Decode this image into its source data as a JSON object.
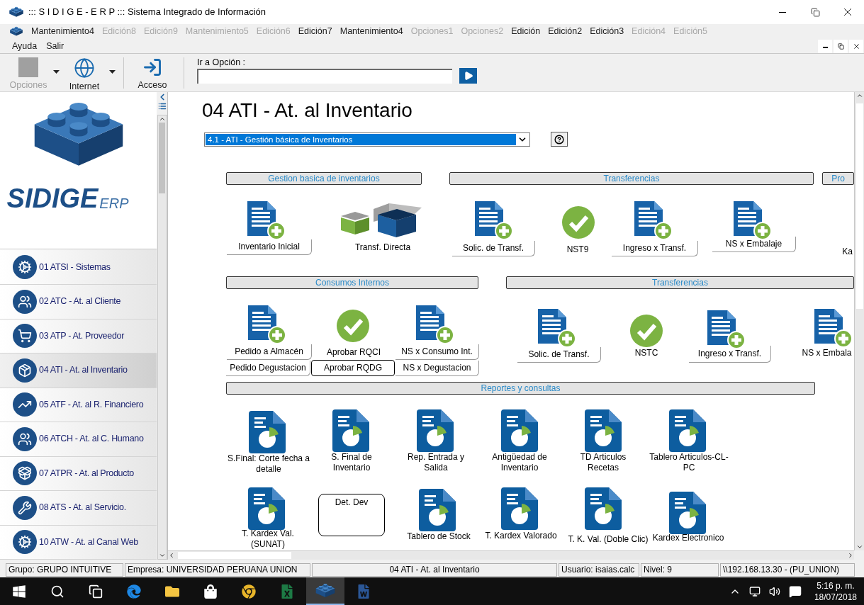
{
  "window": {
    "title": "::: S I D I G E - E R P ::: Sistema Integrado de Información"
  },
  "menu": [
    {
      "label": "Mantenimiento4",
      "disabled": false
    },
    {
      "label": "Edición8",
      "disabled": true
    },
    {
      "label": "Edición9",
      "disabled": true
    },
    {
      "label": "Mantenimiento5",
      "disabled": true
    },
    {
      "label": "Edición6",
      "disabled": true
    },
    {
      "label": "Edición7",
      "disabled": false
    },
    {
      "label": "Mantenimiento4",
      "disabled": false
    },
    {
      "label": "Opciones1",
      "disabled": true
    },
    {
      "label": "Opciones2",
      "disabled": true
    },
    {
      "label": "Edición",
      "disabled": false
    },
    {
      "label": "Edición2",
      "disabled": false
    },
    {
      "label": "Edición3",
      "disabled": false
    },
    {
      "label": "Edición4",
      "disabled": true
    },
    {
      "label": "Edición5",
      "disabled": true
    }
  ],
  "menu_row2": [
    {
      "label": "Ayuda",
      "disabled": false
    },
    {
      "label": "Salir",
      "disabled": false
    }
  ],
  "toolbar": {
    "buttons": [
      {
        "label": "Opciones",
        "kind": "blank",
        "disabled": true,
        "dropdown": true
      },
      {
        "label": "Internet",
        "kind": "globe",
        "disabled": false,
        "dropdown": true
      },
      {
        "label": "Acceso",
        "kind": "door",
        "disabled": false,
        "dropdown": false
      }
    ],
    "goto_label": "Ir a Opción :"
  },
  "sidebar": {
    "logo": {
      "name": "SIDIGE",
      "suffix": "ERP"
    },
    "items": [
      {
        "label": "01 ATSI - Sistemas",
        "kind": "gears",
        "selected": false
      },
      {
        "label": "02 ATC - At. al Cliente",
        "kind": "people",
        "selected": false
      },
      {
        "label": "03  ATP - At. Proveedor",
        "kind": "cart",
        "selected": false
      },
      {
        "label": "04 ATI - At. al Inventario",
        "kind": "box",
        "selected": true
      },
      {
        "label": "05 ATF - At. al R. Financiero",
        "kind": "chart",
        "selected": false
      },
      {
        "label": "06 ATCH - At. al C. Humano",
        "kind": "group",
        "selected": false
      },
      {
        "label": "07 ATPR - At. al Producto",
        "kind": "package",
        "selected": false
      },
      {
        "label": "08 ATS - At. al Servicio.",
        "kind": "tools",
        "selected": false
      },
      {
        "label": "10 ATW - At. al Canal Web",
        "kind": "gears",
        "selected": false
      }
    ]
  },
  "page": {
    "title": "04 ATI - At. al Inventario",
    "dropdown": {
      "value": "4.1 - ATI - Gestión básica de Inventarios"
    }
  },
  "sections": [
    {
      "title": "Gestion basica de inventarios"
    },
    {
      "title": "Transferencias"
    },
    {
      "title": "Pro"
    },
    {
      "title": "Consumos Internos"
    },
    {
      "title": "Transferencias"
    },
    {
      "title": "Reportes y consultas"
    }
  ],
  "tiles": [
    {
      "kind": "doc-add",
      "label": "Inventario Inicial"
    },
    {
      "kind": "boxes",
      "label": "Transf. Directa"
    },
    {
      "kind": "doc-add",
      "label": "Solic. de Transf."
    },
    {
      "kind": "check",
      "label": "NST9"
    },
    {
      "kind": "doc-add",
      "label": "Ingreso x Transf."
    },
    {
      "kind": "doc-add",
      "label": "NS x Embalaje"
    },
    {
      "kind": "text",
      "label": "Ka"
    },
    {
      "kind": "doc-add",
      "label": "Pedido a Almacén"
    },
    {
      "kind": "check",
      "label": "Aprobar RQCI"
    },
    {
      "kind": "doc-add",
      "label": "NS x Consumo Int."
    },
    {
      "kind": "text",
      "label": "Pedido Degustacion"
    },
    {
      "kind": "text",
      "label": "Aprobar RQDG"
    },
    {
      "kind": "text",
      "label": "NS x Degustacion"
    },
    {
      "kind": "doc-add",
      "label": "Solic. de Transf."
    },
    {
      "kind": "check",
      "label": "NSTC"
    },
    {
      "kind": "doc-add",
      "label": "Ingreso x Transf."
    },
    {
      "kind": "doc-add",
      "label": "NS x Embala"
    },
    {
      "kind": "report",
      "label": "S.Final: Corte fecha a detalle"
    },
    {
      "kind": "report",
      "label": "S. Final de Inventario"
    },
    {
      "kind": "report",
      "label": "Rep. Entrada y Salida"
    },
    {
      "kind": "report",
      "label": "Antigüedad de Inventario"
    },
    {
      "kind": "report",
      "label": "TD Articulos Recetas"
    },
    {
      "kind": "report",
      "label": "Tablero Articulos-CL-PC"
    },
    {
      "kind": "report",
      "label": "T. Kardex Val. (SUNAT)"
    },
    {
      "kind": "text",
      "label": "Det. Dev"
    },
    {
      "kind": "report",
      "label": "Tablero de Stock"
    },
    {
      "kind": "report",
      "label": "T. Kardex Valorado"
    },
    {
      "kind": "report",
      "label": "T. K. Val. (Doble Clic)"
    },
    {
      "kind": "report",
      "label": "Kardex Electronico"
    }
  ],
  "status_bar": [
    "Grupo: GRUPO INTUITIVE",
    "Empresa: UNIVERSIDAD PERUANA UNION",
    "04 ATI - At. al Inventario",
    "Usuario: isaias.calc",
    "Nivel: 9",
    "\\\\192.168.13.30 - (PU_UNION)"
  ],
  "taskbar": {
    "apps": [
      {
        "kind": "start",
        "selected": false
      },
      {
        "kind": "search",
        "selected": false
      },
      {
        "kind": "task-view",
        "selected": false
      },
      {
        "kind": "edge",
        "selected": false
      },
      {
        "kind": "explorer",
        "selected": false
      },
      {
        "kind": "store",
        "selected": false
      },
      {
        "kind": "chrome",
        "selected": false
      },
      {
        "kind": "excel",
        "selected": false
      },
      {
        "kind": "sidige",
        "selected": true
      },
      {
        "kind": "word",
        "selected": false
      }
    ],
    "time": "5:16 p. m.",
    "date": "18/07/2018"
  }
}
